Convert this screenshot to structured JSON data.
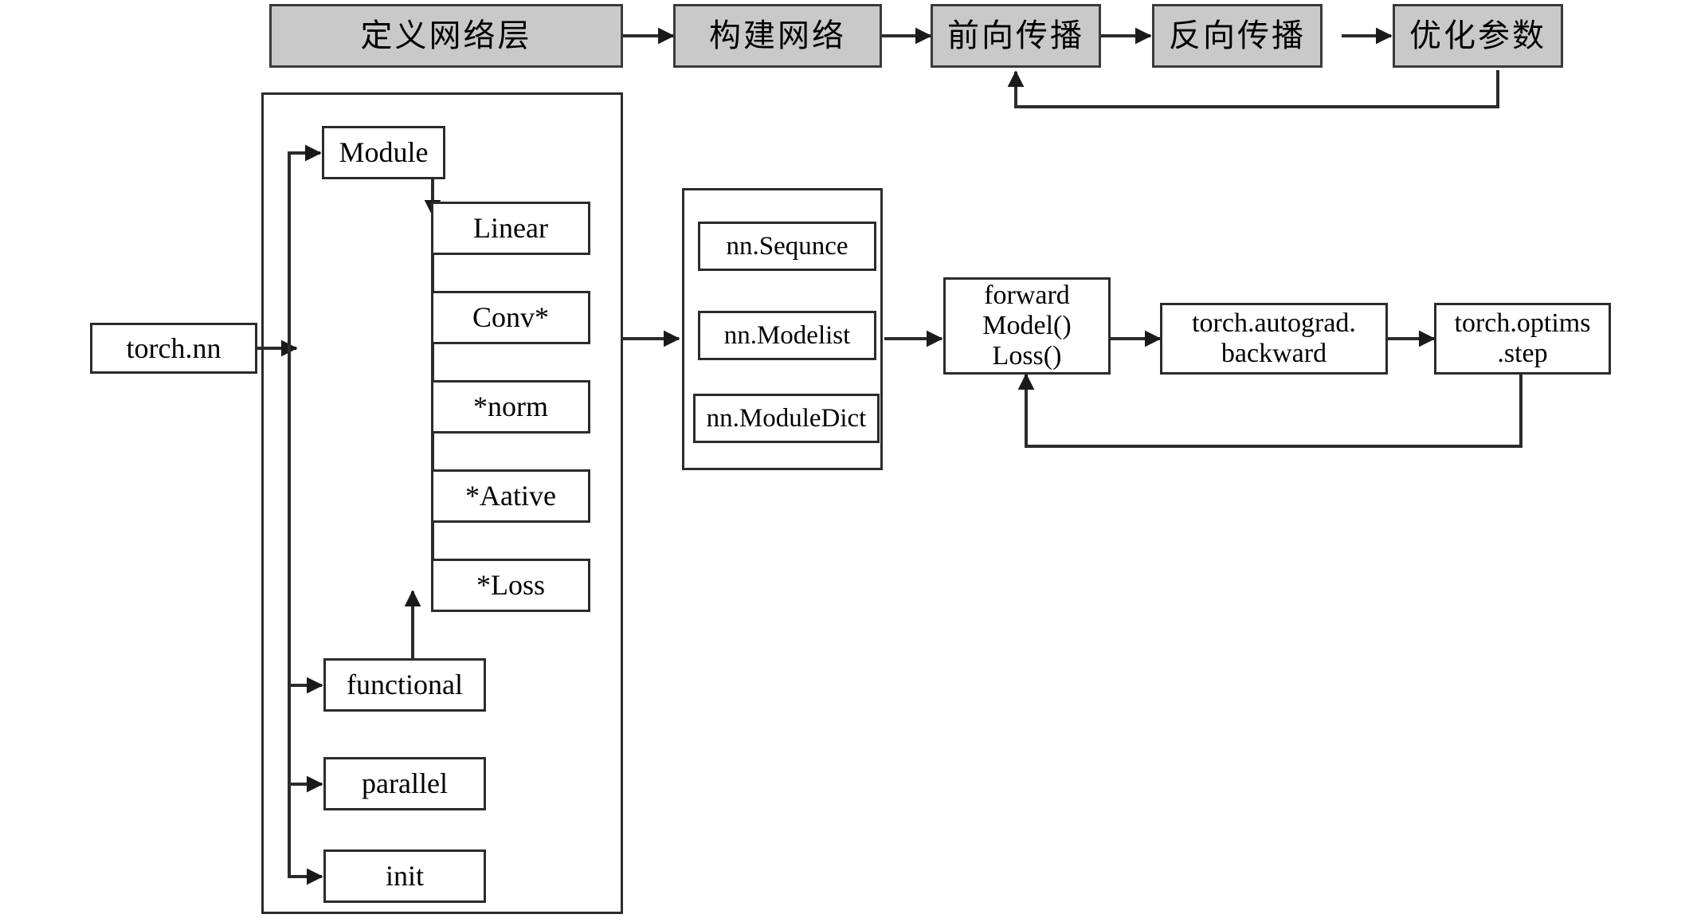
{
  "diagram": {
    "title": "PyTorch torch.nn training pipeline diagram",
    "stroke_color": "#2b2b2b",
    "gray_fill": "#c9c9c9",
    "white_fill": "#ffffff"
  },
  "pipeline": {
    "steps": [
      {
        "id": "define-layer",
        "label": "定义网络层"
      },
      {
        "id": "build-network",
        "label": "构建网络"
      },
      {
        "id": "forward-prop",
        "label": "前向传播"
      },
      {
        "id": "backward-prop",
        "label": "反向传播"
      },
      {
        "id": "optimize-params",
        "label": "优化参数"
      }
    ]
  },
  "entry": {
    "label": "torch.nn"
  },
  "nn_module_group": {
    "root": {
      "id": "module",
      "label": "Module"
    },
    "layers": [
      {
        "id": "linear",
        "label": "Linear"
      },
      {
        "id": "conv",
        "label": "Conv*"
      },
      {
        "id": "norm",
        "label": "*norm"
      },
      {
        "id": "aative",
        "label": "*Aative"
      },
      {
        "id": "loss",
        "label": "*Loss"
      }
    ],
    "submodules": [
      {
        "id": "functional",
        "label": "functional"
      },
      {
        "id": "parallel",
        "label": "parallel"
      },
      {
        "id": "init",
        "label": "init"
      }
    ]
  },
  "container_group": {
    "items": [
      {
        "id": "nn-sequnce",
        "label": "nn.Sequnce"
      },
      {
        "id": "nn-modelist",
        "label": "nn.Modelist"
      },
      {
        "id": "nn-moduledict",
        "label": "nn.ModuleDict"
      }
    ]
  },
  "execution": {
    "forward_box": {
      "id": "forward-model-loss",
      "label": "forward\nModel()\nLoss()"
    },
    "backward_box": {
      "id": "autograd-backward",
      "label": "torch.autograd.\nbackward"
    },
    "optimizer_box": {
      "id": "optims-step",
      "label": "torch.optims\n.step"
    }
  }
}
